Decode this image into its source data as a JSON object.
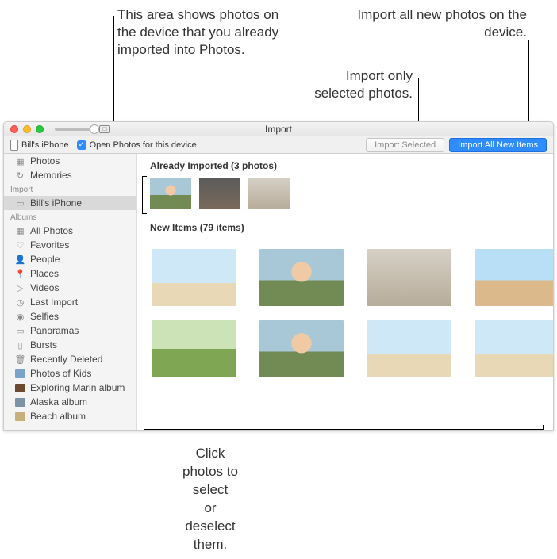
{
  "callouts": {
    "left": "This area shows photos on the device that you already imported into Photos.",
    "right": "Import all new photos on the device.",
    "mid": "Import only selected photos.",
    "bottom_l1": "Click photos to select",
    "bottom_l2": "or deselect them."
  },
  "window": {
    "title": "Import"
  },
  "toolbar": {
    "device_name": "Bill's iPhone",
    "open_photos_label": "Open Photos for this device",
    "open_photos_checked": true,
    "import_selected_label": "Import Selected",
    "import_all_label": "Import All New Items"
  },
  "sidebar": {
    "top": [
      {
        "icon": "photos",
        "label": "Photos"
      },
      {
        "icon": "memories",
        "label": "Memories"
      }
    ],
    "import_header": "Import",
    "import_items": [
      {
        "icon": "device",
        "label": "Bill's iPhone",
        "selected": true
      }
    ],
    "albums_header": "Albums",
    "albums": [
      {
        "icon": "grid",
        "label": "All Photos"
      },
      {
        "icon": "heart",
        "label": "Favorites"
      },
      {
        "icon": "person",
        "label": "People"
      },
      {
        "icon": "pin",
        "label": "Places"
      },
      {
        "icon": "video",
        "label": "Videos"
      },
      {
        "icon": "clock",
        "label": "Last Import"
      },
      {
        "icon": "camera",
        "label": "Selfies"
      },
      {
        "icon": "pano",
        "label": "Panoramas"
      },
      {
        "icon": "burst",
        "label": "Bursts"
      },
      {
        "icon": "trash",
        "label": "Recently Deleted"
      },
      {
        "icon": "swatch",
        "label": "Photos of Kids",
        "color": "#7aa3c9"
      },
      {
        "icon": "swatch",
        "label": "Exploring Marin album",
        "color": "#6b4a2e"
      },
      {
        "icon": "swatch",
        "label": "Alaska album",
        "color": "#7c93a6"
      },
      {
        "icon": "swatch",
        "label": "Beach album",
        "color": "#c7b07a"
      }
    ]
  },
  "main": {
    "already_header": "Already Imported (3 photos)",
    "already_count": 3,
    "new_header": "New Items (79 items)",
    "new_count": 79,
    "already_thumbs": [
      "people",
      "dim",
      "indoor"
    ],
    "new_thumbs": [
      "beach",
      "people",
      "indoor",
      "sky",
      "green",
      "people",
      "beach",
      "beach"
    ]
  },
  "icons": {
    "photos": "▦",
    "memories": "↻",
    "device": "▭",
    "grid": "▦",
    "heart": "♡",
    "person": "👤",
    "pin": "📍",
    "video": "▷",
    "clock": "◷",
    "camera": "◉",
    "pano": "▭",
    "burst": "▯",
    "trash": "🗑"
  }
}
